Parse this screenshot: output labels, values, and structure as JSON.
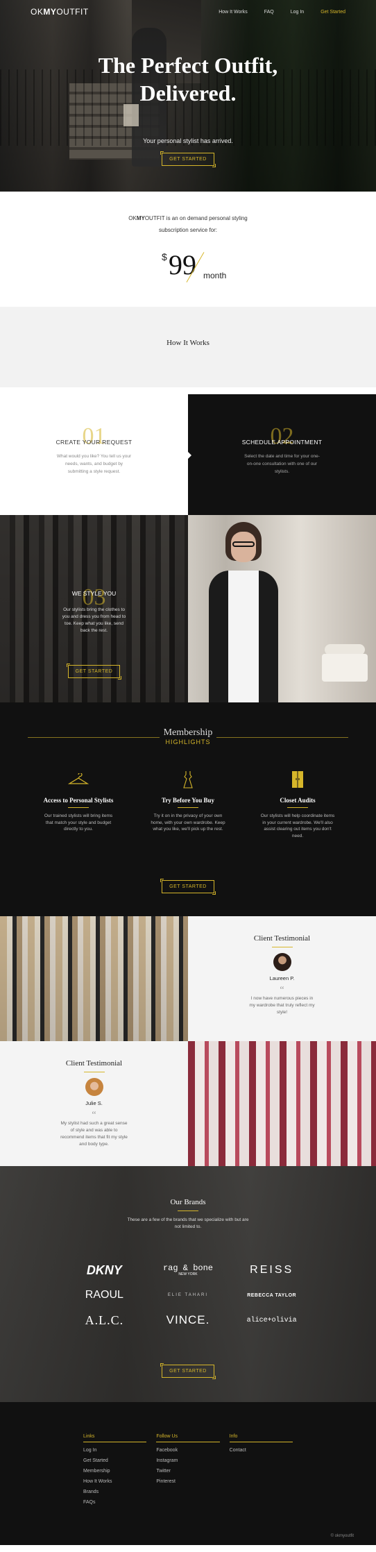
{
  "nav": {
    "logo_pre": "OK",
    "logo_bold": "MY",
    "logo_post": "OUTFIT",
    "links": [
      "How It Works",
      "FAQ",
      "Log In",
      "Get Started"
    ]
  },
  "hero": {
    "title_line1": "The Perfect Outfit,",
    "title_line2": "Delivered.",
    "subtitle": "Your personal stylist has arrived.",
    "button": "GET STARTED"
  },
  "pricing": {
    "brand_pre": "OK",
    "brand_bold": "MY",
    "brand_post": "OUTFIT",
    "line1_rest": " is an on demand personal styling",
    "line2": "subscription service for:",
    "currency": "$",
    "amount": "99",
    "period": "month"
  },
  "how_it_works": {
    "title": "How It Works"
  },
  "steps": [
    {
      "number": "01",
      "title": "CREATE YOUR REQUEST",
      "text": "What would you like? You tell us your needs, wants, and budget by submitting a style request."
    },
    {
      "number": "02",
      "title": "SCHEDULE APPOINTMENT",
      "text": "Select the date and time for your one-on-one consultation with one of our stylists."
    },
    {
      "number": "03",
      "title": "WE STYLE YOU",
      "text": "Our stylists bring the clothes to you and dress you from head to toe. Keep what you like, send back the rest.",
      "button": "GET STARTED"
    }
  ],
  "membership": {
    "title": "Membership",
    "subtitle": "HIGHLIGHTS",
    "features": [
      {
        "icon": "hanger-icon",
        "title": "Access to Personal Stylists",
        "text": "Our trained stylists will bring items that match your style and budget directly to you."
      },
      {
        "icon": "dress-icon",
        "title": "Try Before You Buy",
        "text": "Try it on in the privacy of your own home, with your own wardrobe. Keep what you like, we'll pick up the rest."
      },
      {
        "icon": "closet-icon",
        "title": "Closet Audits",
        "text": "Our stylists will help coordinate items in your current wardrobe. We'll also assist clearing out items you don't need."
      }
    ],
    "button": "GET STARTED"
  },
  "testimonials": [
    {
      "title": "Client Testimonial",
      "name": "Laureen P.",
      "quote_mark": "“",
      "text": "I now have numerous pieces in my wardrobe that truly reflect my style!"
    },
    {
      "title": "Client Testimonial",
      "name": "Julie S.",
      "quote_mark": "“",
      "text": "My stylist had such a great sense of style and was able to recommend items that fit my style and body type."
    }
  ],
  "brands": {
    "title": "Our Brands",
    "intro": "These are a few of the brands that we specialize with but are not limited to.",
    "list": [
      "DKNY",
      "rag & bone",
      "REISS",
      "RAOUL",
      "ELIE TAHARI",
      "REBECCA TAYLOR",
      "A.L.C.",
      "VINCE.",
      "alice+olivia"
    ],
    "ragbone_sub": "NEW YORK",
    "button": "GET STARTED"
  },
  "footer": {
    "columns": [
      {
        "title": "Links",
        "items": [
          "Log In",
          "Get Started",
          "Membership",
          "How It Works",
          "Brands",
          "FAQs"
        ]
      },
      {
        "title": "Follow Us",
        "items": [
          "Facebook",
          "Instagram",
          "Twitter",
          "Pinterest"
        ]
      },
      {
        "title": "Info",
        "items": [
          "Contact"
        ]
      }
    ],
    "copyright": "© okmyoutfit"
  },
  "colors": {
    "accent": "#d6b62a",
    "dark": "#111111",
    "light": "#f4f4f4"
  }
}
